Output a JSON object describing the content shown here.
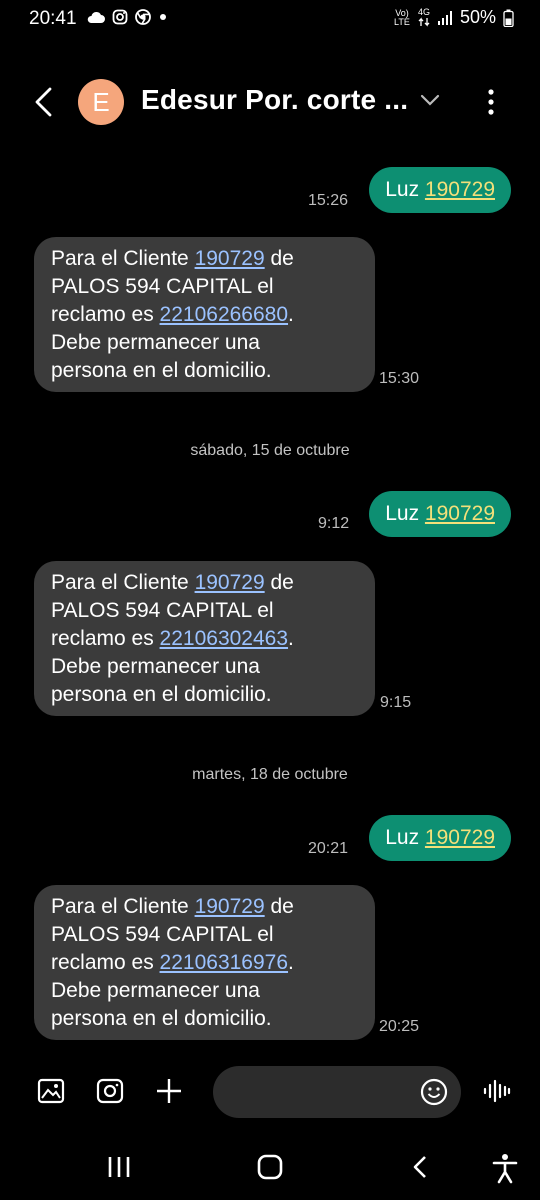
{
  "status_bar": {
    "time": "20:41",
    "volte": "Vo) LTE",
    "network": "4G",
    "battery": "50%",
    "left_icons": [
      "cloud-icon",
      "instagram-icon",
      "chrome-icon",
      "dot-icon"
    ]
  },
  "header": {
    "avatar_letter": "E",
    "title": "Edesur Por. corte ...",
    "avatar_color": "#f5a67c"
  },
  "messages": [
    {
      "dir": "out",
      "prefix": "Luz ",
      "link": "190729",
      "time": "15:26"
    },
    {
      "dir": "in",
      "line1_prefix": "Para el Cliente ",
      "client": "190729",
      "line1_suffix": " de",
      "line2": "PALOS 594 CAPITAL el",
      "line3_prefix": "reclamo es ",
      "claim": "22106266680",
      "line3_suffix": ".",
      "line4": "Debe permanecer una",
      "line5": "persona en el domicilio.",
      "time": "15:30"
    },
    {
      "dir": "date",
      "label": "sábado, 15 de octubre"
    },
    {
      "dir": "out",
      "prefix": "Luz ",
      "link": "190729",
      "time": "9:12"
    },
    {
      "dir": "in",
      "line1_prefix": "Para el Cliente ",
      "client": "190729",
      "line1_suffix": " de",
      "line2": "PALOS 594 CAPITAL el",
      "line3_prefix": "reclamo es ",
      "claim": "22106302463",
      "line3_suffix": ".",
      "line4": "Debe permanecer una",
      "line5": "persona en el domicilio.",
      "time": "9:15"
    },
    {
      "dir": "date",
      "label": "martes, 18 de octubre"
    },
    {
      "dir": "out",
      "prefix": "Luz ",
      "link": "190729",
      "time": "20:21"
    },
    {
      "dir": "in",
      "line1_prefix": "Para el Cliente ",
      "client": "190729",
      "line1_suffix": " de",
      "line2": "PALOS 594 CAPITAL el",
      "line3_prefix": "reclamo es ",
      "claim": "22106316976",
      "line3_suffix": ".",
      "line4": "Debe permanecer una",
      "line5": "persona en el domicilio.",
      "time": "20:25"
    }
  ],
  "composer": {
    "placeholder": "",
    "icons": [
      "gallery-icon",
      "camera-icon",
      "plus-icon",
      "emoji-icon",
      "voice-icon"
    ]
  },
  "nav_bar": {
    "icons": [
      "recents-icon",
      "home-icon",
      "back-icon",
      "accessibility-icon"
    ]
  },
  "colors": {
    "outgoing_bubble": "#0d8f72",
    "incoming_bubble": "#3b3b3b",
    "outgoing_link": "#f3e07a",
    "incoming_link": "#9bc2ff",
    "background": "#000000"
  }
}
